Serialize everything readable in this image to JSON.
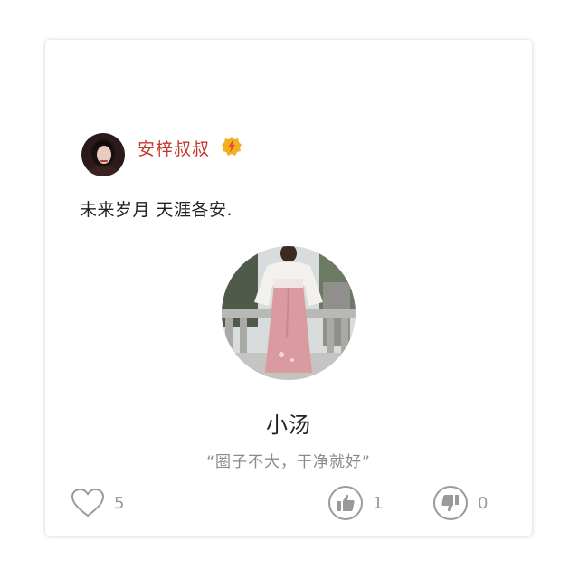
{
  "post": {
    "author_name": "安梓叔叔",
    "text": "未来岁月 天涯各安."
  },
  "profile": {
    "nickname": "小汤",
    "signature": "“圈子不大，干净就好”"
  },
  "actions": {
    "like_count": "5",
    "thumbup_count": "1",
    "thumbdown_count": "0"
  },
  "icons": {
    "author_badge": "vip-lightning-badge-icon",
    "like": "heart-outline-icon",
    "thumbup": "thumbs-up-icon",
    "thumbdown": "thumbs-down-icon"
  },
  "colors": {
    "author_name": "#c0392b",
    "badge": "#f2b01e",
    "icon_gray": "#9a9a9a",
    "text_main": "#222222",
    "text_muted": "#8a8a8a"
  }
}
